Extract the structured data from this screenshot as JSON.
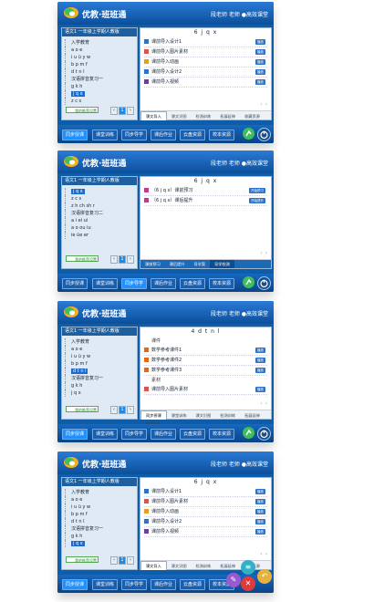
{
  "brand": "优教·班班通",
  "teacher": "段老师 老师 ●高效课堂",
  "left_title": "语文1 一年级上学期人教版",
  "fav": "我的推荐设置",
  "panels": [
    {
      "tree": [
        "入学教育",
        "a o e",
        "i u ü y w",
        "b p m f",
        "d t n l",
        "汉语拼音复习一",
        "g k h",
        "j q x",
        "z c s"
      ],
      "selected": "j q x",
      "title": "6 j q x",
      "rows": [
        {
          "icon": "doc",
          "label": "课前导入设计1",
          "btn": "播放"
        },
        {
          "icon": "img",
          "label": "课前导入图片素材",
          "btn": "播放"
        },
        {
          "icon": "vid",
          "label": "课前导入动画",
          "btn": "播放"
        },
        {
          "icon": "doc",
          "label": "课前导入设计2",
          "btn": "播放"
        },
        {
          "icon": "cam",
          "label": "课前导入视频",
          "btn": "播放"
        }
      ],
      "tabs": [
        "课文导入",
        "课文识图",
        "检测训练",
        "拓展延伸",
        "收藏资源"
      ],
      "tab_on": 0,
      "nav": [
        "同步授课",
        "课堂训练",
        "同步导学",
        "课后作业",
        "云盘资源",
        "校本资源"
      ],
      "nav_on": 0
    },
    {
      "tree": [
        "j q x",
        "z c s",
        "z h ch sh r",
        "汉语拼音复习二",
        "a i ei ui",
        "a o ou iu",
        "ie üe er"
      ],
      "selected": "j q x",
      "title": "6 j q x",
      "rows": [
        {
          "icon": "pk",
          "label": "（6 j q x）课前预习",
          "btn": "开始预习"
        },
        {
          "icon": "pk",
          "label": "（6 j q x）课后提升",
          "btn": "开始提升"
        }
      ],
      "tabs": [
        "课前预习",
        "课后提升",
        "导学案",
        "导学检测"
      ],
      "tab_on": 3,
      "nav": [
        "同步授课",
        "课堂训练",
        "同步导学",
        "课后作业",
        "云盘资源",
        "校本资源"
      ],
      "nav_on": 2
    },
    {
      "tree": [
        "入学教育",
        "a o e",
        "i u ü y w",
        "b p m f",
        "d t n l",
        "汉语拼音复习一",
        "g k h",
        "j q x"
      ],
      "selected": "d t n l",
      "title": "4 d t n l",
      "rows": [
        {
          "icon": "sec",
          "label": "课件",
          "btn": ""
        },
        {
          "icon": "ppt",
          "label": "数学参考课件1",
          "btn": "播放"
        },
        {
          "icon": "ppt",
          "label": "数学参考课件2",
          "btn": "播放"
        },
        {
          "icon": "ppt",
          "label": "数学参考课件3",
          "btn": "播放"
        },
        {
          "icon": "sec",
          "label": "素材",
          "btn": ""
        },
        {
          "icon": "img",
          "label": "课前导入图片素材",
          "btn": "播放"
        }
      ],
      "tabs": [
        "同步授课",
        "课堂训练",
        "课文识图",
        "检测训练",
        "拓展延伸",
        "收藏资源"
      ],
      "tab_on": 0,
      "nav": [
        "同步授课",
        "课堂训练",
        "同步导学",
        "课后作业",
        "云盘资源",
        "校本资源"
      ],
      "nav_on": 0
    },
    {
      "tree": [
        "入学教育",
        "a o e",
        "i u ü y w",
        "b p m f",
        "d t n l",
        "汉语拼音复习一",
        "g k h",
        "j q x"
      ],
      "selected": "j q x",
      "title": "6 j q x",
      "rows": [
        {
          "icon": "doc",
          "label": "课前导入设计1",
          "btn": "播放"
        },
        {
          "icon": "img",
          "label": "课前导入图片素材",
          "btn": "播放"
        },
        {
          "icon": "vid",
          "label": "课前导入动画",
          "btn": "播放"
        },
        {
          "icon": "doc",
          "label": "课前导入设计2",
          "btn": "播放"
        },
        {
          "icon": "cam",
          "label": "课前导入视频",
          "btn": "播放"
        }
      ],
      "tabs": [
        "课文导入",
        "课文识图",
        "检测训练",
        "拓展延伸",
        "收藏资源"
      ],
      "tab_on": 0,
      "nav": [
        "同步授课",
        "课堂训练",
        "同步导学",
        "课后作业",
        "云盘资源",
        "校本资源"
      ],
      "nav_on": 0
    }
  ],
  "colors": {
    "accent": "#1d8ae8",
    "header": "#0b4f9a",
    "play": "#2b73c9",
    "green": "#3fbf5a"
  }
}
